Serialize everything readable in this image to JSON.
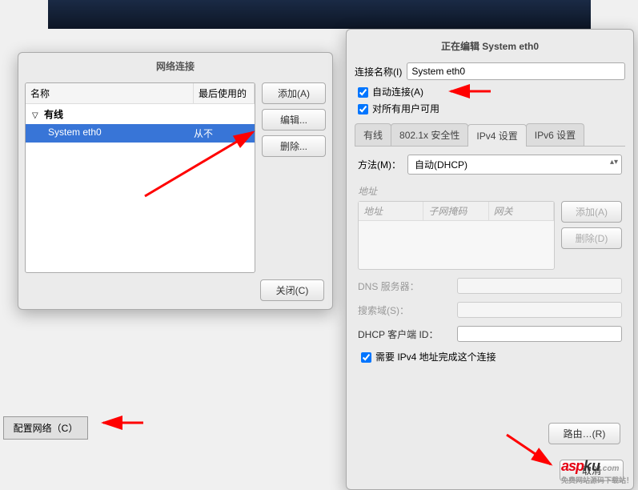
{
  "topBanner": {},
  "connectionsDialog": {
    "title": "网络连接",
    "columns": {
      "name": "名称",
      "last": "最后使用的"
    },
    "group": {
      "label": "有线"
    },
    "item": {
      "name": "System eth0",
      "last": "从不"
    },
    "buttons": {
      "add": "添加(A)",
      "edit": "编辑...",
      "delete": "删除...",
      "close": "关闭(C)"
    }
  },
  "configNetworkButton": "配置网络（C）",
  "editDialog": {
    "title": "正在编辑 System eth0",
    "nameLabel": "连接名称(I)",
    "nameValue": "System eth0",
    "autoConnect": "自动连接(A)",
    "allUsers": "对所有用户可用",
    "tabs": {
      "wired": "有线",
      "security": "802.1x 安全性",
      "ipv4": "IPv4 设置",
      "ipv6": "IPv6 设置"
    },
    "method": {
      "label": "方法(M)：",
      "value": "自动(DHCP)"
    },
    "addresses": {
      "label": "地址",
      "cols": {
        "addr": "地址",
        "mask": "子网掩码",
        "gw": "网关"
      },
      "add": "添加(A)",
      "delete": "删除(D)"
    },
    "dns": "DNS 服务器：",
    "search": "搜索域(S)：",
    "dhcpClient": "DHCP 客户端 ID：",
    "requireIpv4": "需要 IPv4 地址完成这个连接",
    "routes": "路由…(R)",
    "cancel": "取消",
    "save": ""
  },
  "watermark": {
    "brand1": "asp",
    "brand2": "ku",
    "tld": ".com",
    "sub": "免费网站源码下载站！"
  }
}
